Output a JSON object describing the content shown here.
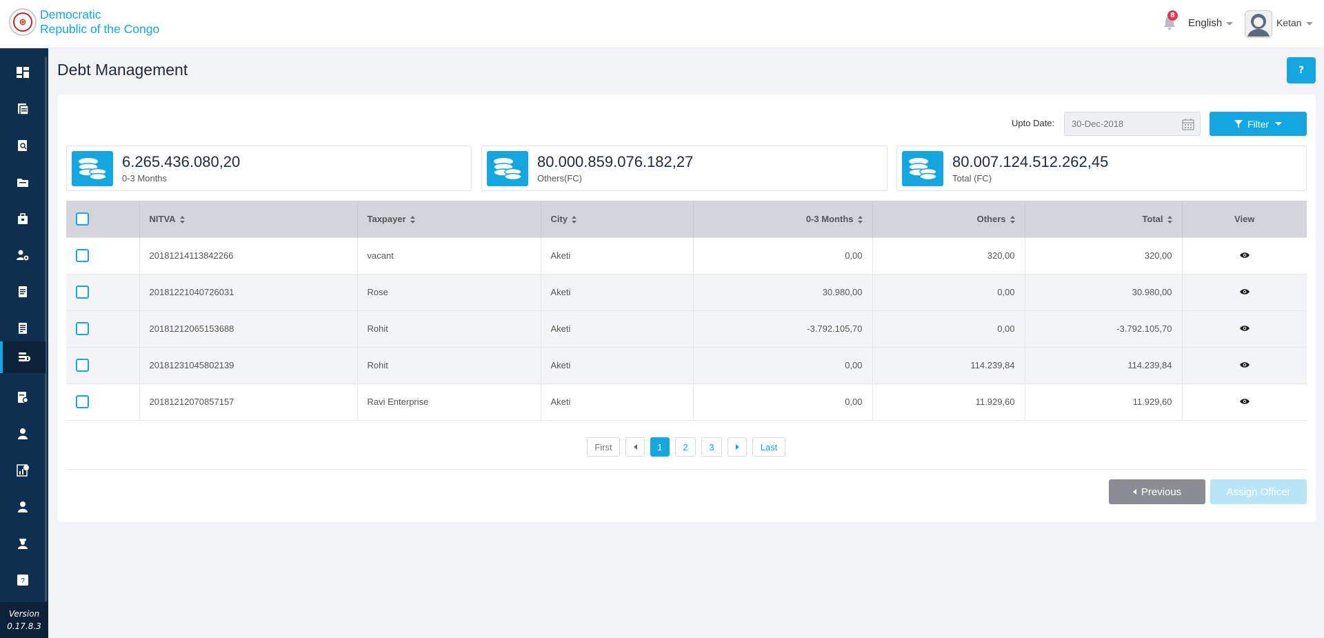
{
  "header": {
    "brand_line1": "Democratic",
    "brand_line2": "Republic of the Congo",
    "notification_count": "8",
    "language": "English",
    "user_name": "Ketan"
  },
  "sidebar": {
    "items": [
      {
        "icon": "dashboard-icon"
      },
      {
        "icon": "registration-icon"
      },
      {
        "icon": "search-document-icon"
      },
      {
        "icon": "folder-icon"
      },
      {
        "icon": "briefcase-icon"
      },
      {
        "icon": "settings-user-icon"
      },
      {
        "icon": "document-icon"
      },
      {
        "icon": "invoice-icon"
      },
      {
        "icon": "debt-management-icon",
        "active": true
      },
      {
        "icon": "report-search-icon"
      },
      {
        "icon": "user-icon"
      },
      {
        "icon": "chart-icon"
      },
      {
        "icon": "person-icon"
      },
      {
        "icon": "officer-icon"
      },
      {
        "icon": "help-icon"
      }
    ],
    "version_label": "Version",
    "version_number": "0.17.8.3"
  },
  "page": {
    "title": "Debt Management",
    "help_label": "?"
  },
  "toolbar": {
    "upto_label": "Upto Date:",
    "date_value": "30-Dec-2018",
    "filter_label": "Filter"
  },
  "stats": [
    {
      "value": "6.265.436.080,20",
      "label": "0-3 Months"
    },
    {
      "value": "80.000.859.076.182,27",
      "label": "Others(FC)"
    },
    {
      "value": "80.007.124.512.262,45",
      "label": "Total (FC)"
    }
  ],
  "table": {
    "headers": {
      "nitva": "NITVA",
      "taxpayer": "Taxpayer",
      "city": "City",
      "months": "0-3 Months",
      "others": "Others",
      "total": "Total",
      "view": "View"
    },
    "rows": [
      {
        "nitva": "20181214113842266",
        "taxpayer": "vacant",
        "city": "Aketi",
        "months": "0,00",
        "others": "320,00",
        "total": "320,00"
      },
      {
        "nitva": "20181221040726031",
        "taxpayer": "Rose",
        "city": "Aketi",
        "months": "30.980,00",
        "others": "0,00",
        "total": "30.980,00"
      },
      {
        "nitva": "20181212065153688",
        "taxpayer": "Rohit",
        "city": "Aketi",
        "months": "-3.792.105,70",
        "others": "0,00",
        "total": "-3.792.105,70"
      },
      {
        "nitva": "20181231045802139",
        "taxpayer": "Rohit",
        "city": "Aketi",
        "months": "0,00",
        "others": "114.239,84",
        "total": "114.239,84"
      },
      {
        "nitva": "20181212070857157",
        "taxpayer": "Ravi Enterprise",
        "city": "Aketi",
        "months": "0,00",
        "others": "11.929,60",
        "total": "11.929,60"
      }
    ]
  },
  "pagination": {
    "first": "First",
    "last": "Last",
    "pages": [
      "1",
      "2",
      "3"
    ],
    "current": "1"
  },
  "actions": {
    "previous_label": "Previous",
    "assign_label": "Assign Officer"
  },
  "colors": {
    "accent": "#13a6e0",
    "sidebar": "#0f2f4f",
    "badge": "#f0304b"
  }
}
